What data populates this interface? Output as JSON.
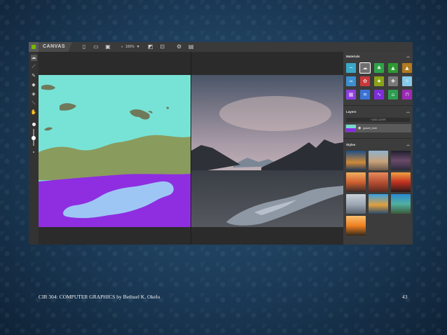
{
  "toolbar": {
    "brand": "CANVAS",
    "zoom": "100%",
    "icons": [
      "new-file-icon",
      "open-folder-icon",
      "save-icon",
      "zoom-icon",
      "image-frame-icon",
      "export-icon",
      "settings-icon",
      "comment-icon"
    ]
  },
  "tools": [
    "layer-palette-icon",
    "brush-icon",
    "pencil-icon",
    "eraser-icon",
    "fill-bucket-icon",
    "eyedropper-icon",
    "pan-hand-icon"
  ],
  "panel": {
    "materials_title": "Materials",
    "layers_title": "Layers",
    "add_layer": "+ ADD LAYER",
    "layer_name": "gravel_river",
    "styles_title": "Styles"
  },
  "material_colors": [
    "#3aa8c8",
    "#6f6f6f",
    "#2fa24a",
    "#2c9a30",
    "#b07a1e",
    "#3c8fd0",
    "#c8393b",
    "#8aa216",
    "#7a7a7a",
    "#86c9e8",
    "#8d3fe0",
    "#3a73d6",
    "#7d2ed8",
    "#2f9d52",
    "#9c2ab5"
  ],
  "segmentation_colors": {
    "sky": "#77e3d6",
    "hills": "#8a9b5e",
    "gravel": "#8e2ee0",
    "river": "#9ec6f5"
  },
  "footer": {
    "course": "CIR 304: COMPUTER GRAPHICS by Bethuel K. Okelo",
    "page": "43"
  }
}
